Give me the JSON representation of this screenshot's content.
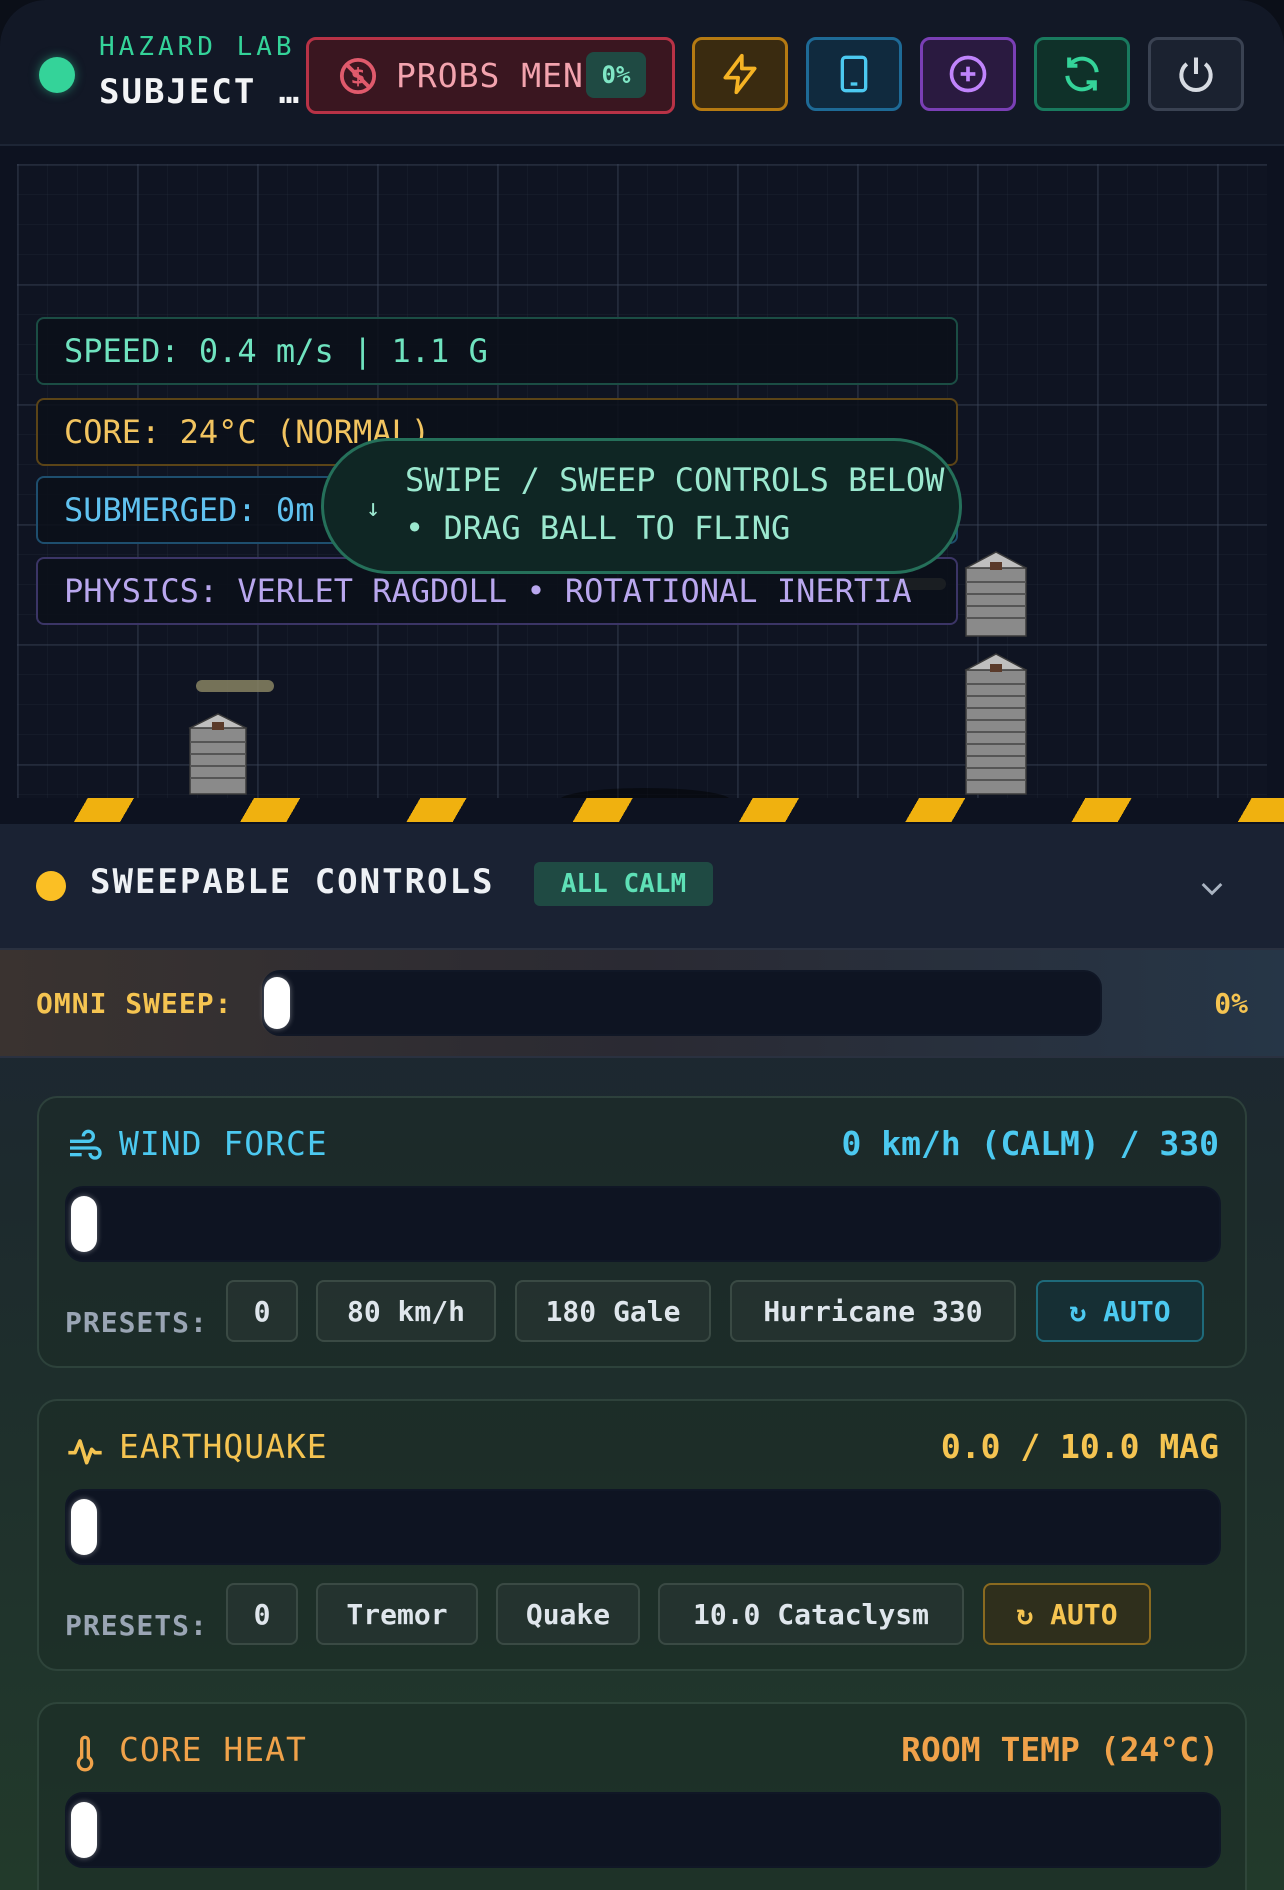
{
  "header": {
    "app_subtitle": "HAZARD LAB •",
    "app_title": "SUBJECT …",
    "probs_label": "PROBS MENU",
    "probs_percent": "0%",
    "tools": [
      "bolt-icon",
      "tablet-icon",
      "plus-circle-icon",
      "refresh-icon",
      "power-icon"
    ]
  },
  "scene": {
    "speed": "SPEED: 0.4 m/s | 1.1 G",
    "core": "CORE: 24°C (NORMAL)",
    "submerged": "SUBMERGED: 0m",
    "physics": "PHYSICS: VERLET RAGDOLL • ROTATIONAL INERTIA",
    "hint_arrow": "↓",
    "hint_line1": "SWIPE / SWEEP CONTROLS BELOW",
    "hint_line2": "• DRAG BALL TO FLING"
  },
  "controls": {
    "title": "SWEEPABLE CONTROLS",
    "badge": "ALL CALM",
    "omni_label": "OMNI SWEEP:",
    "omni_value": "0%",
    "omni_level": 0,
    "wind": {
      "title": "WIND FORCE",
      "value": "0 km/h (CALM) / 330",
      "level": 0,
      "presets_label": "PRESETS:",
      "presets": [
        "0",
        "80 km/h",
        "180 Gale",
        "Hurricane 330"
      ],
      "auto": "↻ AUTO"
    },
    "quake": {
      "title": "EARTHQUAKE",
      "value": "0.0 / 10.0 MAG",
      "level": 0,
      "presets_label": "PRESETS:",
      "presets": [
        "0",
        "Tremor",
        "Quake",
        "10.0 Cataclysm"
      ],
      "auto": "↻ AUTO"
    },
    "heat": {
      "title": "CORE HEAT",
      "value": "ROOM TEMP (24°C)",
      "level": 0
    }
  },
  "colors": {
    "accent_green": "#34d399",
    "accent_yellow": "#fbbf24",
    "accent_red": "#b83246",
    "wind": "#4cc9f0",
    "quake": "#f5c451",
    "heat": "#f0a24a"
  }
}
